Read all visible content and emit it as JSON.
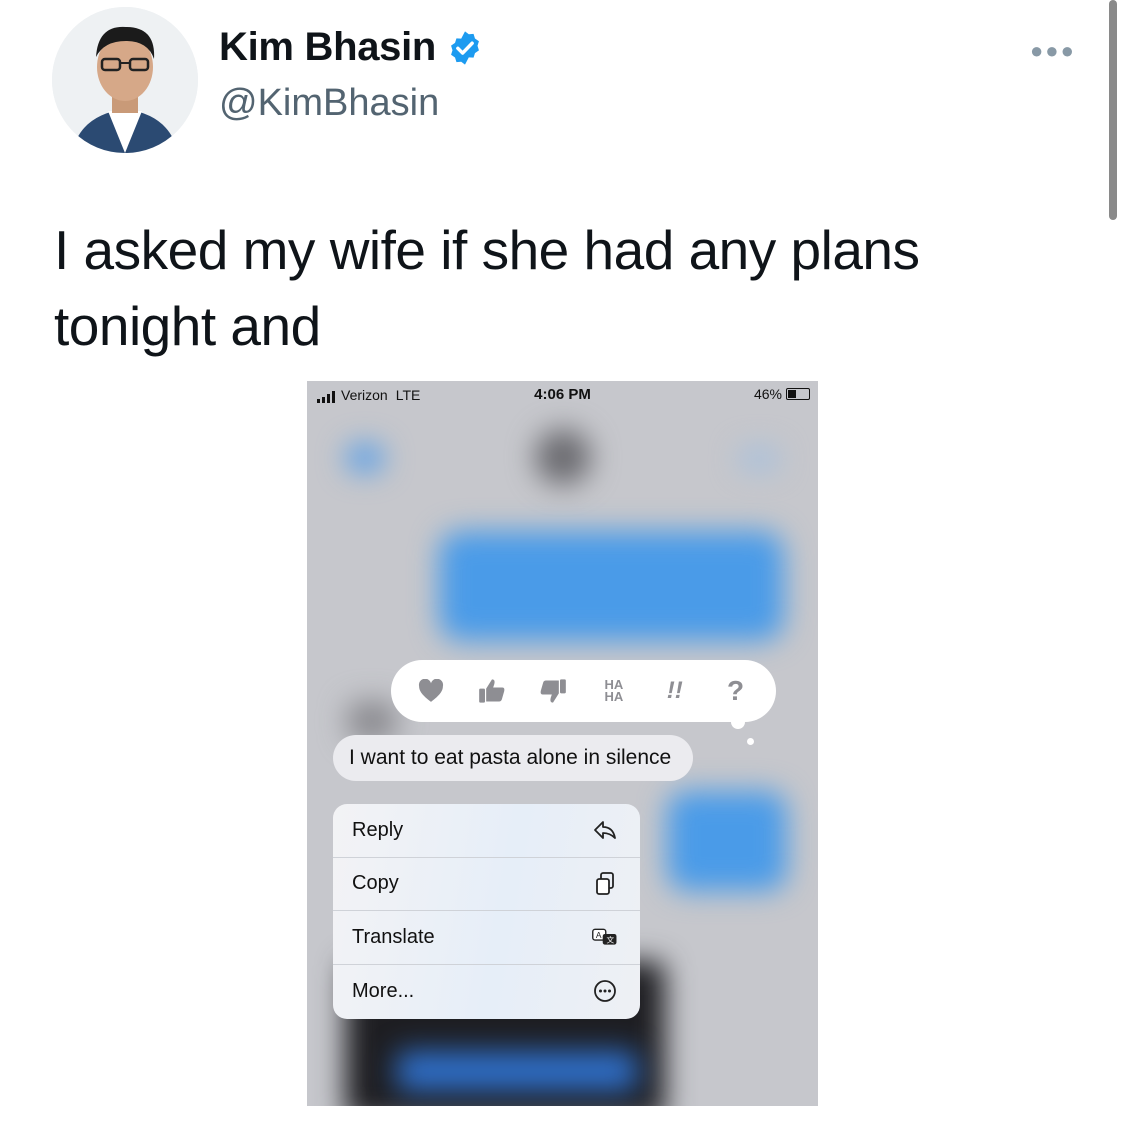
{
  "tweet": {
    "author_name": "Kim Bhasin",
    "handle": "@KimBhasin",
    "text": "I asked my wife if she had any plans tonight and",
    "more_icon": "more-dots-icon",
    "verified_icon": "verified-badge-icon"
  },
  "phone": {
    "status": {
      "carrier": "Verizon",
      "network": "LTE",
      "time": "4:06 PM",
      "battery": "46%"
    },
    "tapbacks": [
      {
        "name": "heart",
        "label": ""
      },
      {
        "name": "thumbs-up",
        "label": ""
      },
      {
        "name": "thumbs-down",
        "label": ""
      },
      {
        "name": "haha",
        "label": "HA\nHA"
      },
      {
        "name": "emphasize",
        "label": "!!"
      },
      {
        "name": "question",
        "label": "?"
      }
    ],
    "message": "I want to eat pasta alone in silence",
    "menu": [
      {
        "label": "Reply",
        "icon": "reply-icon"
      },
      {
        "label": "Copy",
        "icon": "copy-icon"
      },
      {
        "label": "Translate",
        "icon": "translate-icon"
      },
      {
        "label": "More...",
        "icon": "more-circle-icon"
      }
    ]
  },
  "colors": {
    "verified": "#1d9bf0",
    "imessage_blue": "#4a9be8",
    "handle_gray": "#536471"
  }
}
